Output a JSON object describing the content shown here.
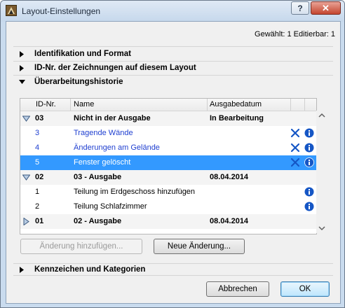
{
  "window": {
    "title": "Layout-Einstellungen",
    "help_label": "?",
    "close_label": "✕"
  },
  "selection_info": "Gewählt: 1 Editierbar: 1",
  "sections": [
    {
      "label": "Identifikation und Format",
      "expanded": false
    },
    {
      "label": "ID-Nr. der Zeichnungen auf diesem Layout",
      "expanded": false
    },
    {
      "label": "Überarbeitungshistorie",
      "expanded": true
    },
    {
      "label": "Kennzeichen und Kategorien",
      "expanded": false
    }
  ],
  "table": {
    "columns": [
      "ID-Nr.",
      "Name",
      "Ausgabedatum"
    ],
    "rows": [
      {
        "type": "group",
        "expanded": true,
        "id": "03",
        "name": "Nicht in der Ausgabe",
        "date": "In Bearbeitung"
      },
      {
        "type": "item",
        "style": "blue",
        "id": "3",
        "name": "Tragende Wände",
        "date": "",
        "icons": [
          "delete-icon",
          "info-icon"
        ]
      },
      {
        "type": "item",
        "style": "blue",
        "id": "4",
        "name": "Änderungen am Gelände",
        "date": "",
        "icons": [
          "delete-icon",
          "info-icon"
        ]
      },
      {
        "type": "item",
        "style": "selected",
        "id": "5",
        "name": "Fenster gelöscht",
        "date": "",
        "icons": [
          "delete-icon",
          "info-icon"
        ]
      },
      {
        "type": "group",
        "expanded": true,
        "id": "02",
        "name": "03 - Ausgabe",
        "date": "08.04.2014"
      },
      {
        "type": "item",
        "style": "normal",
        "id": "1",
        "name": "Teilung im Erdgeschoss hinzufügen",
        "date": "",
        "icons": [
          "info-icon"
        ]
      },
      {
        "type": "item",
        "style": "normal",
        "id": "2",
        "name": "Teilung Schlafzimmer",
        "date": "",
        "icons": [
          "info-icon"
        ]
      },
      {
        "type": "group",
        "expanded": false,
        "id": "01",
        "name": "02 - Ausgabe",
        "date": "08.04.2014"
      }
    ]
  },
  "buttons": {
    "add_change": "Änderung hinzufügen...",
    "new_change": "Neue Änderung...",
    "cancel": "Abbrechen",
    "ok": "OK"
  },
  "colors": {
    "selection": "#3399ff",
    "link_blue": "#1f3fd0",
    "icon_blue": "#1556c5"
  }
}
